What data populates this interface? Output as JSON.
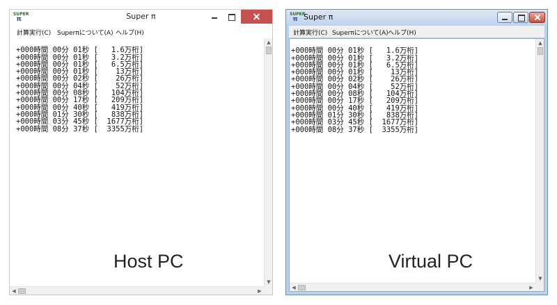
{
  "host_window": {
    "title": "Super π",
    "icon_top": "SUPER",
    "icon_bottom": "π",
    "menu": [
      "計算実行(C)",
      "Superπについて(A)",
      "ヘルプ(H)"
    ],
    "output_lines": [
      "+000時間 00分 01秒 [   1.6万桁]",
      "+000時間 00分 01秒 [   3.2万桁]",
      "+000時間 00分 01秒 [   6.5万桁]",
      "+000時間 00分 01秒 [    13万桁]",
      "+000時間 00分 02秒 [    26万桁]",
      "+000時間 00分 04秒 [    52万桁]",
      "+000時間 00分 08秒 [   104万桁]",
      "+000時間 00分 17秒 [   209万桁]",
      "+000時間 00分 40秒 [   419万桁]",
      "+000時間 01分 30秒 [   838万桁]",
      "+000時間 03分 45秒 [  1677万桁]",
      "+000時間 08分 37秒 [  3355万桁]"
    ]
  },
  "virtual_window": {
    "title": "Super π",
    "icon_top": "SUPER",
    "icon_bottom": "π",
    "menu": [
      "計算実行(C)",
      "Superπについて(A)",
      "ヘルプ(H)"
    ],
    "output_lines": [
      "+000時間 00分 01秒 [   1.6万桁]",
      "+000時間 00分 01秒 [   3.2万桁]",
      "+000時間 00分 01秒 [   6.5万桁]",
      "+000時間 00分 01秒 [    13万桁]",
      "+000時間 00分 02秒 [    26万桁]",
      "+000時間 00分 04秒 [    52万桁]",
      "+000時間 00分 08秒 [   104万桁]",
      "+000時間 00分 17秒 [   209万桁]",
      "+000時間 00分 40秒 [   419万桁]",
      "+000時間 01分 30秒 [   838万桁]",
      "+000時間 03分 45秒 [  1677万桁]",
      "+000時間 08分 37秒 [  3355万桁]"
    ]
  },
  "captions": {
    "host": "Host PC",
    "virtual": "Virtual PC"
  },
  "icons": {
    "minimize": "minimize-icon",
    "maximize": "maximize-icon",
    "close": "close-icon",
    "app": "super-pi-icon"
  },
  "colors": {
    "host_close_button": "#c75050",
    "virtual_frame": "#b9d1ea"
  }
}
